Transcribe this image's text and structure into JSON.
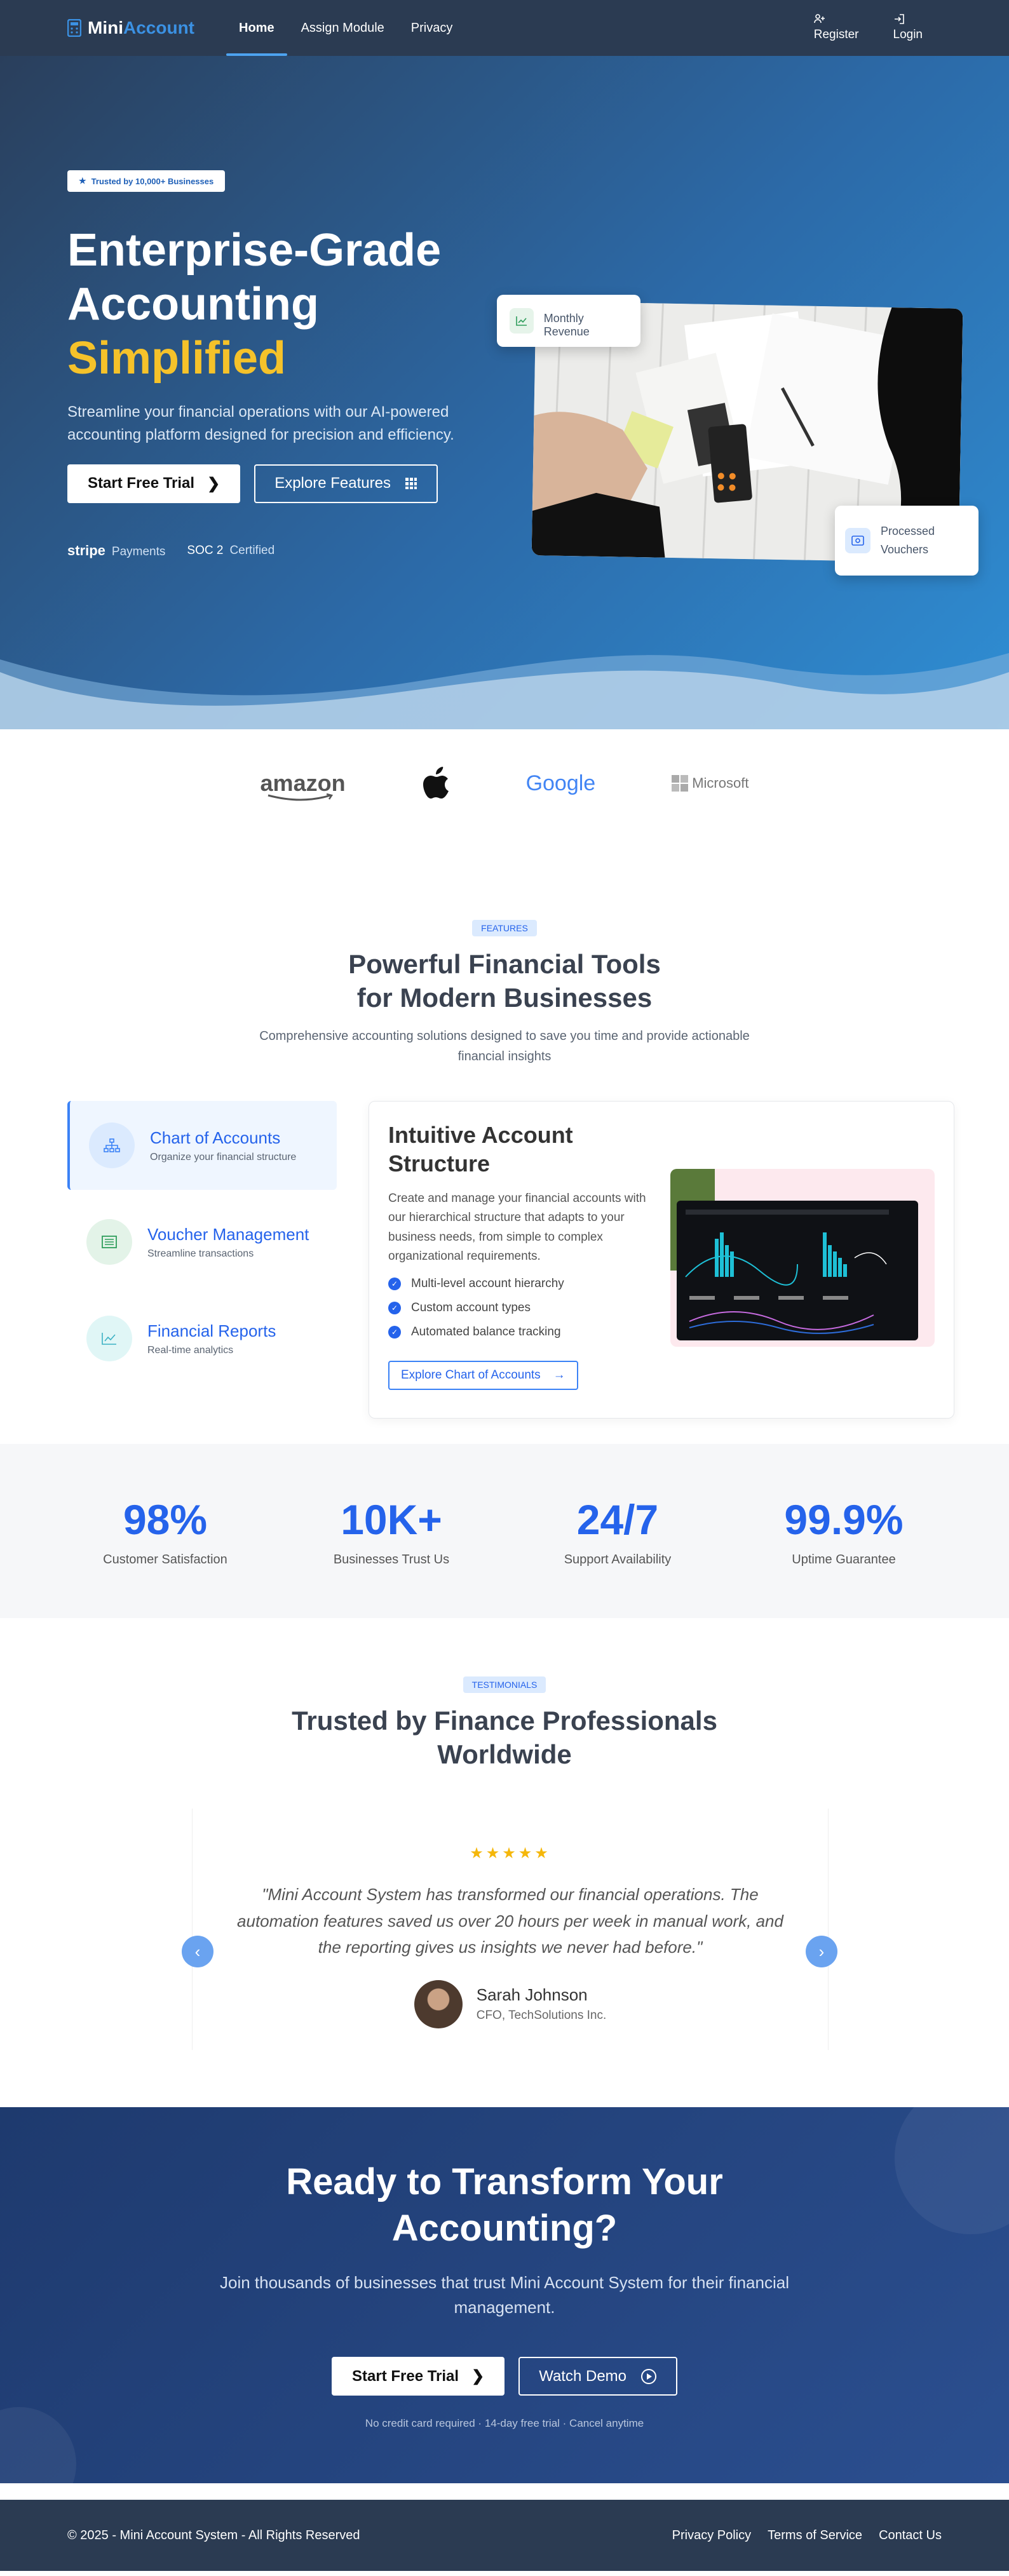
{
  "nav": {
    "brand_a": "Mini",
    "brand_b": "Account",
    "links": [
      "Home",
      "Assign Module",
      "Privacy"
    ],
    "register": "Register",
    "login": "Login"
  },
  "hero": {
    "badge": "Trusted by 10,000+ Businesses",
    "title_1": "Enterprise-Grade",
    "title_2": "Accounting",
    "title_3": "Simplified",
    "lead": "Streamline your financial operations with our AI-powered accounting platform designed for precision and efficiency.",
    "btn_trial": "Start Free Trial",
    "btn_features": "Explore Features",
    "trust_1_logo": "stripe",
    "trust_1_text": "Payments",
    "trust_2_logo": "SOC 2",
    "trust_2_text": "Certified",
    "card_revenue": "Monthly Revenue",
    "card_vouchers": "Processed Vouchers"
  },
  "logos": [
    "amazon",
    "Google",
    "Microsoft"
  ],
  "features": {
    "tag": "FEATURES",
    "title_1": "Powerful Financial Tools",
    "title_2": "for Modern Businesses",
    "sub": "Comprehensive accounting solutions designed to save you time and provide actionable financial insights",
    "items": [
      {
        "title": "Chart of Accounts",
        "desc": "Organize your financial structure"
      },
      {
        "title": "Voucher Management",
        "desc": "Streamline transactions"
      },
      {
        "title": "Financial Reports",
        "desc": "Real-time analytics"
      }
    ],
    "panel_title": "Intuitive Account Structure",
    "panel_text": "Create and manage your financial accounts with our hierarchical structure that adapts to your business needs, from simple to complex organizational requirements.",
    "checks": [
      "Multi-level account hierarchy",
      "Custom account types",
      "Automated balance tracking"
    ],
    "panel_btn": "Explore Chart of Accounts"
  },
  "stats": [
    {
      "n": "98%",
      "l": "Customer Satisfaction"
    },
    {
      "n": "10K+",
      "l": "Businesses Trust Us"
    },
    {
      "n": "24/7",
      "l": "Support Availability"
    },
    {
      "n": "99.9%",
      "l": "Uptime Guarantee"
    }
  ],
  "testimonials": {
    "tag": "TESTIMONIALS",
    "title_1": "Trusted by Finance Professionals",
    "title_2": "Worldwide",
    "stars": "★★★★★",
    "quote": "\"Mini Account System has transformed our financial operations. The automation features saved us over 20 hours per week in manual work, and the reporting gives us insights we never had before.\"",
    "name": "Sarah Johnson",
    "role": "CFO, TechSolutions Inc."
  },
  "cta": {
    "title_1": "Ready to Transform Your",
    "title_2": "Accounting?",
    "text": "Join thousands of businesses that trust Mini Account System for their financial management.",
    "btn_trial": "Start Free Trial",
    "btn_demo": "Watch Demo",
    "note": "No credit card required · 14-day free trial · Cancel anytime"
  },
  "footer": {
    "copy": "© 2025 - Mini Account System - All Rights Reserved",
    "links": [
      "Privacy Policy",
      "Terms of Service",
      "Contact Us"
    ]
  },
  "colors": {
    "accent": "#2563eb",
    "highlight": "#f5c22a",
    "nav_bg": "#2b3b52"
  }
}
